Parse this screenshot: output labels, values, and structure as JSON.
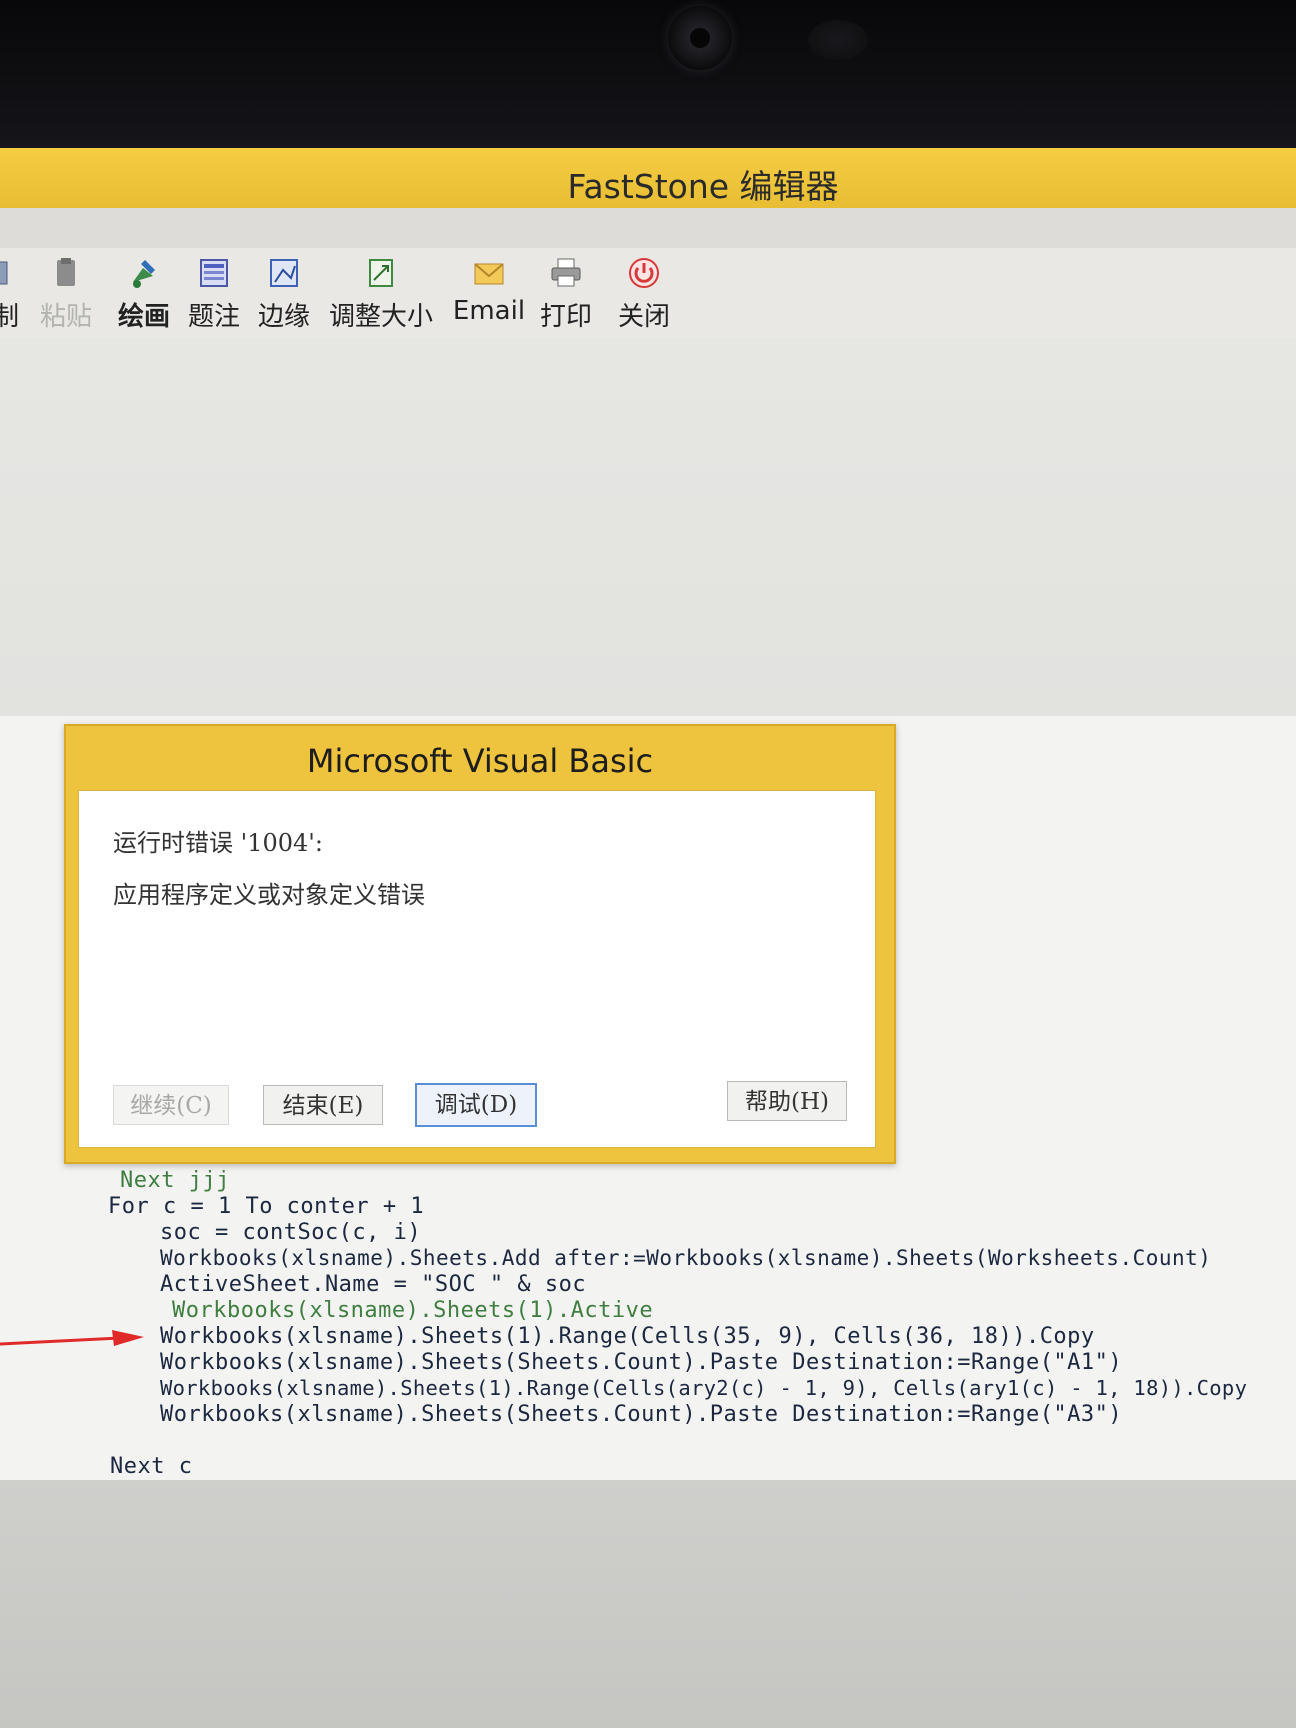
{
  "window": {
    "title": "FastStone 编辑器"
  },
  "toolbar": {
    "items": [
      {
        "label": "制",
        "icon": "copy-icon",
        "state": "normal"
      },
      {
        "label": "粘贴",
        "icon": "paste-icon",
        "state": "disabled"
      },
      {
        "label": "绘画",
        "icon": "draw-icon",
        "state": "bold"
      },
      {
        "label": "题注",
        "icon": "caption-icon",
        "state": "normal"
      },
      {
        "label": "边缘",
        "icon": "edge-icon",
        "state": "normal"
      },
      {
        "label": "调整大小",
        "icon": "resize-icon",
        "state": "normal"
      },
      {
        "label": "Email",
        "icon": "email-icon",
        "state": "normal"
      },
      {
        "label": "打印",
        "icon": "printer-icon",
        "state": "normal"
      },
      {
        "label": "关闭",
        "icon": "power-icon",
        "state": "normal"
      }
    ]
  },
  "dialog": {
    "title": "Microsoft Visual Basic",
    "error_line": "运行时错误 '1004':",
    "error_desc": "应用程序定义或对象定义错误",
    "buttons": {
      "continue": "继续(C)",
      "end": "结束(E)",
      "debug": "调试(D)",
      "help": "帮助(H)"
    }
  },
  "code": {
    "lines": [
      {
        "text": "Next jjj",
        "color": "green"
      },
      {
        "text": "For c = 1 To conter + 1",
        "color": "normal"
      },
      {
        "text": "soc = contSoc(c, i)",
        "color": "normal"
      },
      {
        "text": "Workbooks(xlsname).Sheets.Add after:=Workbooks(xlsname).Sheets(Worksheets.Count)",
        "color": "normal"
      },
      {
        "text": "ActiveSheet.Name = \"SOC \" & soc",
        "color": "normal"
      },
      {
        "text": "Workbooks(xlsname).Sheets(1).Active",
        "color": "green"
      },
      {
        "text": "Workbooks(xlsname).Sheets(1).Range(Cells(35, 9), Cells(36, 18)).Copy",
        "color": "normal"
      },
      {
        "text": "Workbooks(xlsname).Sheets(Sheets.Count).Paste Destination:=Range(\"A1\")",
        "color": "normal"
      },
      {
        "text": "Workbooks(xlsname).Sheets(1).Range(Cells(ary2(c) - 1, 9), Cells(ary1(c) - 1, 18)).Copy",
        "color": "normal"
      },
      {
        "text": "Workbooks(xlsname).Sheets(Sheets.Count).Paste Destination:=Range(\"A3\")",
        "color": "normal"
      },
      {
        "text": "Next c",
        "color": "normal"
      }
    ]
  },
  "colors": {
    "title_bar": "#f0c93e",
    "dialog_frame": "#eec33e",
    "arrow": "#e02a2a"
  }
}
